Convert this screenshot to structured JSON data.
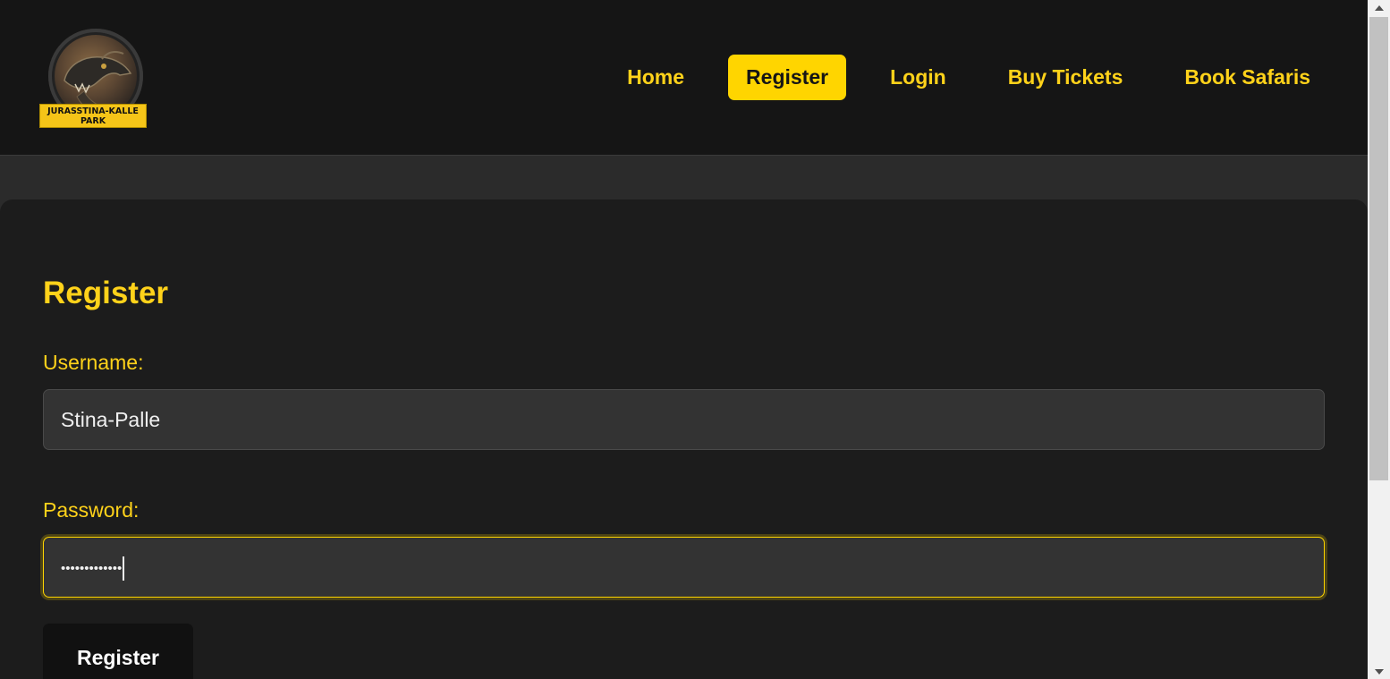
{
  "brand": {
    "logo_text_line1": "JURASSTINA-KALLE",
    "logo_text_line2": "PARK",
    "accent_color": "#ffd500"
  },
  "nav": {
    "items": [
      {
        "label": "Home",
        "active": false
      },
      {
        "label": "Register",
        "active": true
      },
      {
        "label": "Login",
        "active": false
      },
      {
        "label": "Buy Tickets",
        "active": false
      },
      {
        "label": "Book Safaris",
        "active": false
      }
    ]
  },
  "form": {
    "title": "Register",
    "username_label": "Username:",
    "username_value": "Stina-Palle",
    "password_label": "Password:",
    "password_value": "•••••••••••••",
    "submit_label": "Register"
  },
  "icons": {
    "scroll_up": "triangle-up",
    "scroll_down": "triangle-down"
  }
}
